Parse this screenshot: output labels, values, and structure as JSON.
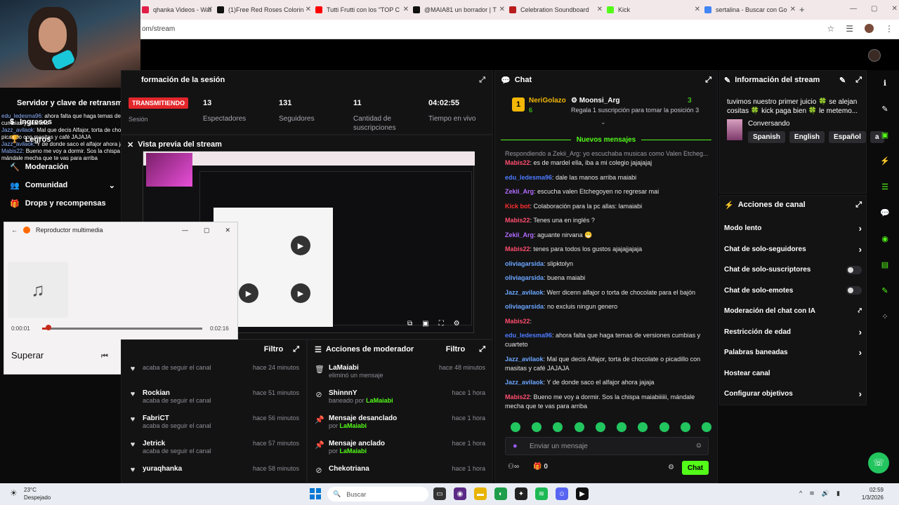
{
  "browser": {
    "tabs": [
      {
        "label": "qhanka Videos - Wat",
        "color": "#e11d48"
      },
      {
        "label": "(1)Free Red Roses Colorin",
        "color": "#111111"
      },
      {
        "label": "Tutti Frutti con los \"TOP C",
        "color": "#ff0000"
      },
      {
        "label": "@MAIA81 un borrador | T",
        "color": "#111111"
      },
      {
        "label": "Celebration Soundboard",
        "color": "#b91c1c"
      },
      {
        "label": "Kick",
        "color": "#53fc18"
      },
      {
        "label": "sertalina - Buscar con Go",
        "color": "#4285f4"
      }
    ],
    "new_tab": "+",
    "url": "om/stream"
  },
  "overlay": {
    "title": "Servidor y clave de retransm",
    "chat": [
      {
        "user": "edu_ledesma96:",
        "text": "ahora falta que haga temas de versiones cumbias y cuarteto"
      },
      {
        "user": "Jazz_avilaok:",
        "text": "Mal que decis Alfajor, torta de chocolate o picadillo con masitas y café JAJAJA"
      },
      {
        "user": "Jazz_avilaok:",
        "text": "Y de donde saco el alfajor ahora jajaja"
      },
      {
        "user": "Mabis22:",
        "text": "Bueno me voy a dormir. Sos la chispa maiabiiiiii, mándale mecha que te vas para arriba"
      }
    ]
  },
  "sidebar": {
    "items": [
      {
        "label": "Ingresos"
      },
      {
        "label": "Legros"
      },
      {
        "label": "Moderación"
      },
      {
        "label": "Comunidad"
      },
      {
        "label": "Drops y recompensas"
      }
    ]
  },
  "session": {
    "title": "formación de la sesión",
    "badge": "TRANSMITIENDO",
    "sub": "Sesión",
    "stats": [
      {
        "value": "13",
        "label": "Espectadores"
      },
      {
        "value": "131",
        "label": "Seguidores"
      },
      {
        "value": "11",
        "label": "Cantidad de suscripciones"
      },
      {
        "value": "04:02:55",
        "label": "Tiempo en vivo"
      }
    ]
  },
  "preview": {
    "title": "Vista previa del stream"
  },
  "media": {
    "title": "Reproductor multimedia",
    "time_current": "0:00:01",
    "time_total": "0:02:16",
    "progress": 0.04,
    "track": "Superar"
  },
  "feed": {
    "filter": "Filtro",
    "items": [
      {
        "name": "",
        "action": "acaba de seguir el canal",
        "time": "hace 24 minutos"
      },
      {
        "name": "Rockian",
        "action": "acaba de seguir el canal",
        "time": "hace 51 minutos"
      },
      {
        "name": "FabriCT",
        "action": "acaba de seguir el canal",
        "time": "hace 56 minutos"
      },
      {
        "name": "Jetrick",
        "action": "acaba de seguir el canal",
        "time": "hace 57 minutos"
      },
      {
        "name": "yuraqhanka",
        "action": "",
        "time": "hace 58 minutos"
      }
    ]
  },
  "modactions": {
    "title": "Acciones de moderador",
    "filter": "Filtro",
    "items": [
      {
        "title": "LaMaiabi",
        "sub": "eliminó un mensaje",
        "by": "",
        "time": "hace 48 minutos"
      },
      {
        "title": "ShinnnY",
        "sub": "baneado por",
        "by": "LaMaiabi",
        "time": "hace 1 hora"
      },
      {
        "title": "Mensaje desanclado",
        "sub": "por",
        "by": "LaMaiabi",
        "time": "hace 1 hora"
      },
      {
        "title": "Mensaje anclado",
        "sub": "por",
        "by": "LaMaiabi",
        "time": "hace 1 hora"
      },
      {
        "title": "Chekotriana",
        "sub": "",
        "by": "",
        "time": "hace 1 hora"
      }
    ]
  },
  "chat": {
    "title": "Chat",
    "leader": {
      "rank": "1",
      "name": "NeriGolazo",
      "count": "6",
      "second_name": "Moonsi_Arg",
      "second_count": "3",
      "gift_text": "Regala 1 suscripción para tomar la posición 3"
    },
    "new_messages": "Nuevos mensajes",
    "reply_to": "Respondiendo a Zekii_Arg: yo escuchaba musicas como Valen Etcheg...",
    "messages": [
      {
        "user": "Mabis22",
        "color": "#ff4d6d",
        "text": ": es de mardel ella, iba a mi colegio jajajajaj"
      },
      {
        "user": "edu_ledesma96",
        "color": "#4d7cff",
        "text": ": dale las manos arriba maiabi"
      },
      {
        "user": "Zekii_Arg",
        "color": "#b36bff",
        "text": ": escucha valen Etchegoyen no regresar mai"
      },
      {
        "user": "Kick bot",
        "color": "#ff2d2d",
        "text": ": Colaboración para la pc allas: lamaiabi"
      },
      {
        "user": "Mabis22",
        "color": "#ff4d6d",
        "text": ": Tenes una en inglés ?"
      },
      {
        "user": "Zekii_Arg",
        "color": "#b36bff",
        "text": ": aguante nirvana 😁"
      },
      {
        "user": "Mabis22",
        "color": "#ff4d6d",
        "text": ": tenes para todos los gustos ajajajjajaja"
      },
      {
        "user": "oliviagarsida",
        "color": "#6ba6ff",
        "text": ": slipktolyn"
      },
      {
        "user": "oliviagarsida",
        "color": "#6ba6ff",
        "text": ": buena maiabi"
      },
      {
        "user": "Jazz_avilaok",
        "color": "#6ba6ff",
        "text": ": Werr dicenn alfajor o torta de chocolate para el bajón"
      },
      {
        "user": "oliviagarsida",
        "color": "#6ba6ff",
        "text": ": no excluis ningun genero"
      },
      {
        "user": "Mabis22",
        "color": "#ff4d6d",
        "text": ":"
      },
      {
        "user": "edu_ledesma96",
        "color": "#4d7cff",
        "text": ": ahora falta que haga temas de versiones cumbias y cuarteto"
      },
      {
        "user": "Jazz_avilaok",
        "color": "#6ba6ff",
        "text": ": Mal que decis Alfajor, torta de chocolate o picadillo con masitas y café JAJAJA"
      },
      {
        "user": "Jazz_avilaok",
        "color": "#6ba6ff",
        "text": ": Y de donde saco el alfajor ahora jajaja"
      },
      {
        "user": "Mabis22",
        "color": "#ff4d6d",
        "text": ": Bueno me voy a dormir. Sos la chispa maiabiiiiii, mándale mecha que te vas para arriba"
      }
    ],
    "placeholder": "Enviar un mensaje",
    "points": "0",
    "send": "Chat"
  },
  "streaminfo": {
    "title": "Información del stream",
    "text": "tuvimos nuestro primer juicio 🍀 se alejan cositas 🍀 kick paga bien 🍀 le metemo...",
    "category": "Conversando",
    "langs": [
      "Spanish",
      "English",
      "Español",
      "a"
    ]
  },
  "channelactions": {
    "title": "Acciones de canal",
    "items": [
      {
        "label": "Modo lento",
        "kind": "chevron"
      },
      {
        "label": "Chat de solo-seguidores",
        "kind": "chevron"
      },
      {
        "label": "Chat de solo-suscriptores",
        "kind": "toggle"
      },
      {
        "label": "Chat de solo-emotes",
        "kind": "toggle"
      },
      {
        "label": "Moderación del chat con IA",
        "kind": "external"
      },
      {
        "label": "Restricción de edad",
        "kind": "chevron"
      },
      {
        "label": "Palabras baneadas",
        "kind": "chevron"
      },
      {
        "label": "Hostear canal",
        "kind": "none"
      },
      {
        "label": "Configurar objetivos",
        "kind": "chevron"
      }
    ]
  },
  "taskbar": {
    "weather_temp": "23°C",
    "weather_desc": "Despejado",
    "search": "Buscar",
    "time": "02:59",
    "date": "1/3/2026"
  },
  "colors": {
    "accent": "#53fc18",
    "live": "#e3262b"
  }
}
